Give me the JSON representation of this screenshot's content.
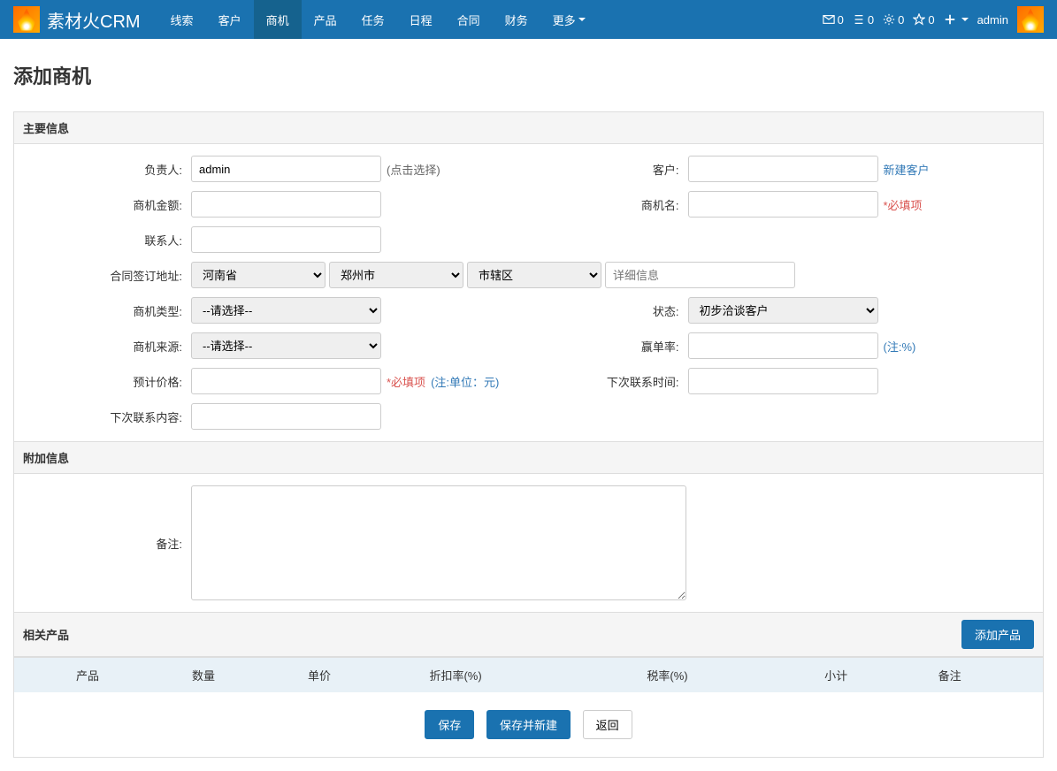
{
  "brand": "素材火CRM",
  "nav": {
    "items": [
      "线索",
      "客户",
      "商机",
      "产品",
      "任务",
      "日程",
      "合同",
      "财务",
      "更多"
    ],
    "active_index": 2,
    "stats": {
      "mail": "0",
      "list": "0",
      "gear": "0",
      "star": "0"
    },
    "username": "admin"
  },
  "page_title": "添加商机",
  "sections": {
    "main": "主要信息",
    "extra": "附加信息",
    "products": "相关产品"
  },
  "fields": {
    "owner": {
      "label": "负责人:",
      "value": "admin",
      "hint": "(点击选择)"
    },
    "customer": {
      "label": "客户:",
      "link": "新建客户"
    },
    "amount": {
      "label": "商机金额:"
    },
    "name": {
      "label": "商机名:",
      "hint": "*必填项"
    },
    "contact": {
      "label": "联系人:"
    },
    "address": {
      "label": "合同签订地址:",
      "province": "河南省",
      "city": "郑州市",
      "district": "市辖区",
      "detail_placeholder": "详细信息"
    },
    "type": {
      "label": "商机类型:",
      "value": "--请选择--"
    },
    "status": {
      "label": "状态:",
      "value": "初步洽谈客户"
    },
    "source": {
      "label": "商机来源:",
      "value": "--请选择--"
    },
    "win_rate": {
      "label": "赢单率:",
      "hint": "(注:%)"
    },
    "price": {
      "label": "预计价格:",
      "hint1": "*必填项",
      "hint2": "(注:单位：元)"
    },
    "next_time": {
      "label": "下次联系时间:"
    },
    "next_content": {
      "label": "下次联系内容:"
    },
    "remark": {
      "label": "备注:"
    }
  },
  "product_table": {
    "add_button": "添加产品",
    "headers": [
      "",
      "产品",
      "数量",
      "单价",
      "折扣率(%)",
      "税率(%)",
      "小计",
      "备注"
    ]
  },
  "actions": {
    "save": "保存",
    "save_new": "保存并新建",
    "back": "返回"
  }
}
